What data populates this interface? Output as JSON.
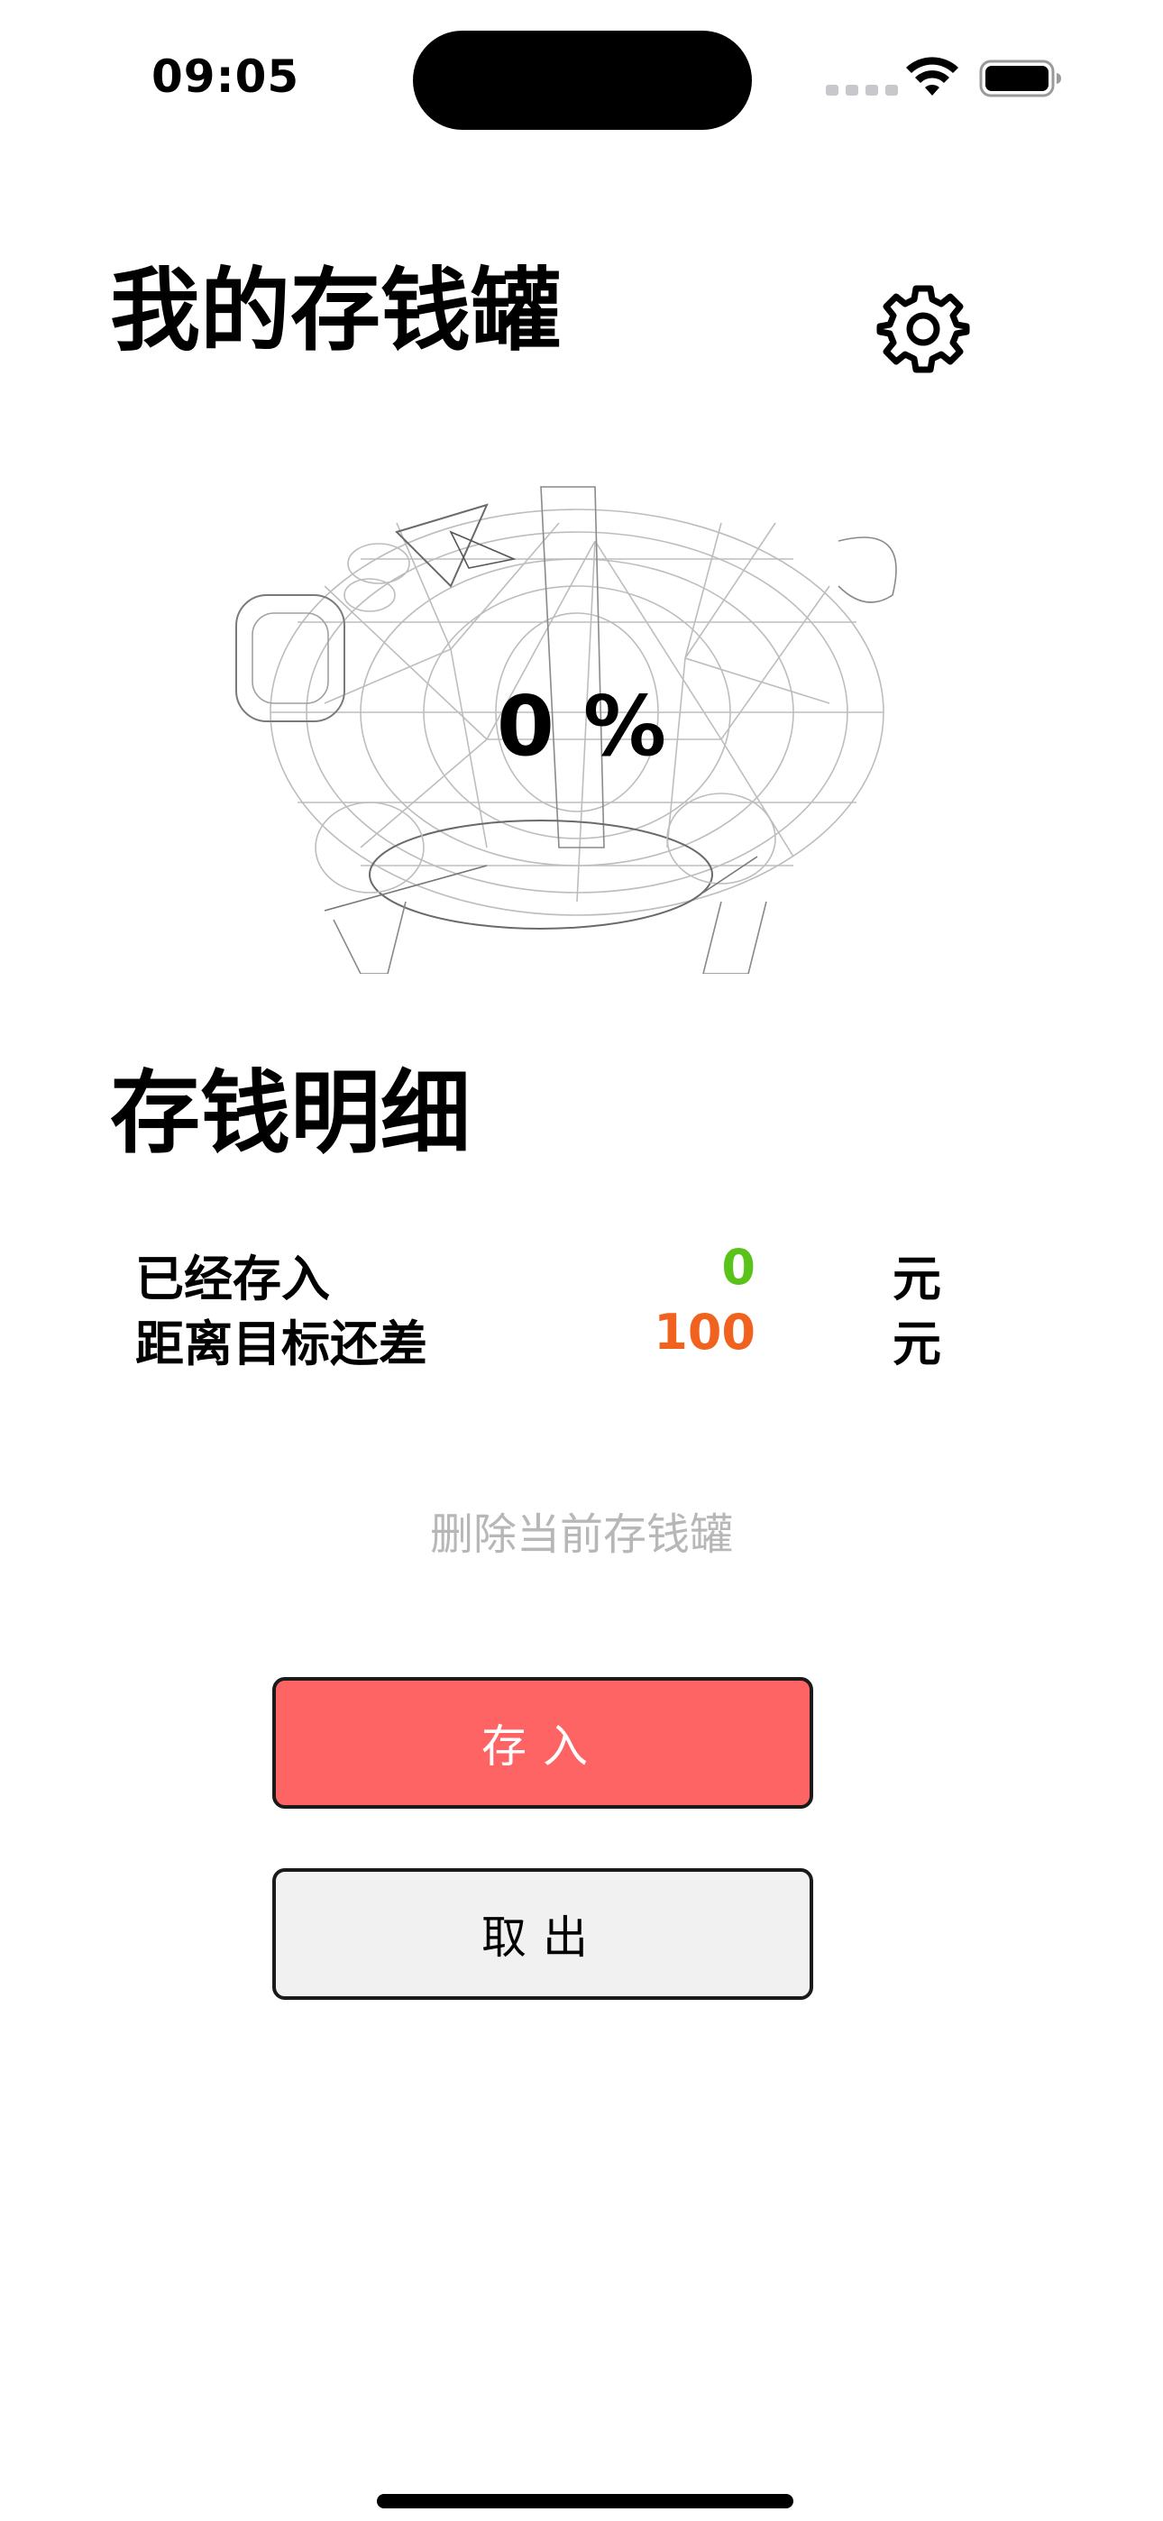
{
  "status_bar": {
    "time": "09:05"
  },
  "header": {
    "title": "我的存钱罐",
    "settings_icon": "gear-icon"
  },
  "piggy": {
    "progress_text": "0 %",
    "progress_fraction": 0
  },
  "details": {
    "title": "存钱明细",
    "rows": [
      {
        "label": "已经存入",
        "value": "0",
        "unit": "元",
        "color": "#5ac31a"
      },
      {
        "label": "距离目标还差",
        "value": "100",
        "unit": "元",
        "color": "#f0621e"
      }
    ]
  },
  "actions": {
    "delete_label": "删除当前存钱罐",
    "deposit_label": "存入",
    "withdraw_label": "取出"
  },
  "colors": {
    "deposit_bg": "#ff6464",
    "withdraw_bg": "#f1f1f1",
    "delete_text": "#b7b7b7"
  }
}
